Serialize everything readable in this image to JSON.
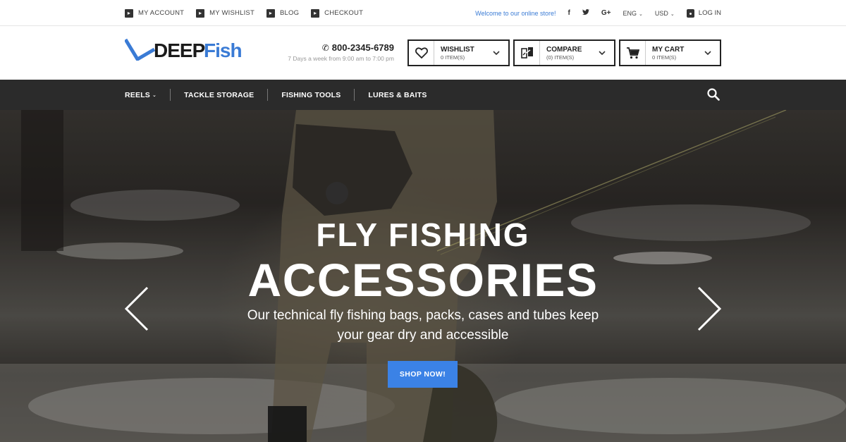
{
  "topbar": {
    "links": [
      {
        "label": "MY ACCOUNT"
      },
      {
        "label": "MY WISHLIST"
      },
      {
        "label": "BLOG"
      },
      {
        "label": "CHECKOUT"
      }
    ],
    "welcome": "Welcome to our online store!",
    "social": {
      "facebook": "f",
      "twitter": "t",
      "google": "G+"
    },
    "language": "ENG",
    "currency": "USD",
    "login": "LOG IN"
  },
  "header": {
    "logo_part1": "DEEP",
    "logo_part2": "Fish",
    "phone": "800-2345-6789",
    "hours": "7 Days a week from 9:00 am to 7:00 pm",
    "wishlist": {
      "title": "WISHLIST",
      "count": "0 ITEM(S)"
    },
    "compare": {
      "title": "COMPARE",
      "count": "(0) ITEM(S)"
    },
    "cart": {
      "title": "MY CART",
      "count": "0 ITEM(S)"
    }
  },
  "nav": {
    "items": [
      {
        "label": "REELS"
      },
      {
        "label": "TACKLE STORAGE"
      },
      {
        "label": "FISHING TOOLS"
      },
      {
        "label": "LURES & BAITS"
      }
    ]
  },
  "hero": {
    "title_line1": "FLY FISHING",
    "title_line2": "ACCESSORIES",
    "subtitle": "Our technical fly fishing bags, packs, cases and tubes keep your gear dry and accessible",
    "button": "SHOP NOW!"
  },
  "colors": {
    "accent": "#3b82e6",
    "brand_blue": "#3a7bd5",
    "nav_bg": "#2b2b2b",
    "text_dark": "#222222"
  },
  "icons": [
    "arrow-square-icon",
    "phone-icon",
    "heart-icon",
    "compare-icon",
    "cart-icon",
    "chevron-down-icon",
    "search-icon",
    "lock-icon",
    "facebook-icon",
    "twitter-icon",
    "google-plus-icon",
    "arrow-left-icon",
    "arrow-right-icon"
  ]
}
